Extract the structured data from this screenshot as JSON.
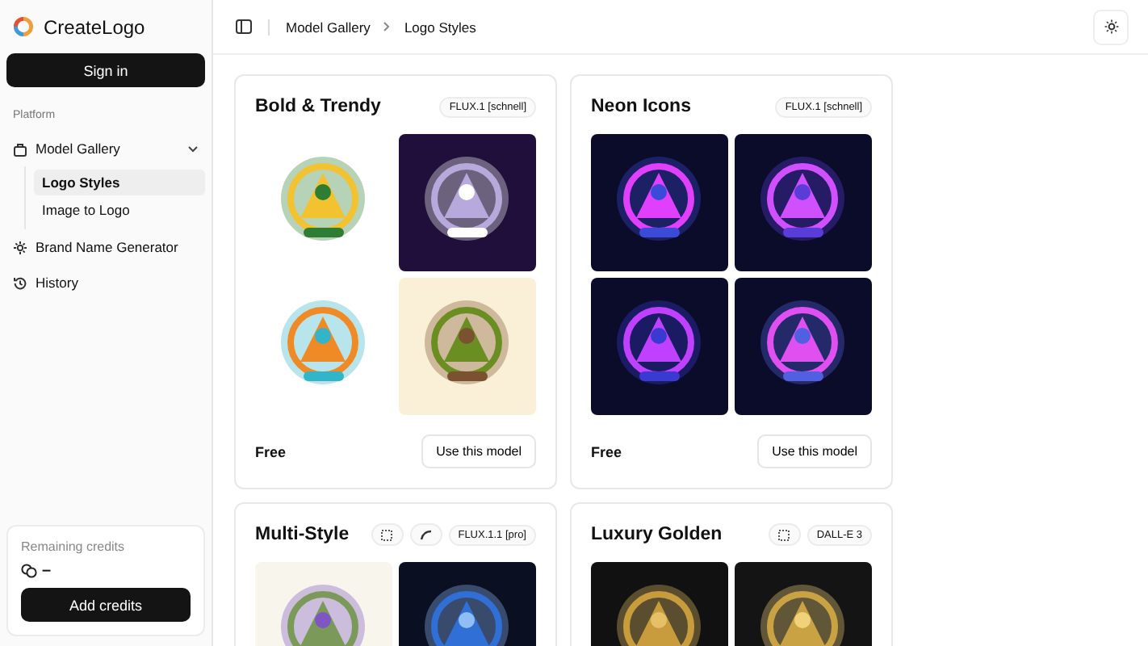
{
  "sidebar": {
    "brand": "CreateLogo",
    "sign_in": "Sign in",
    "section_label": "Platform",
    "items": [
      {
        "label": "Model Gallery",
        "kind": "group",
        "expanded": true,
        "children": [
          {
            "label": "Logo Styles",
            "selected": true
          },
          {
            "label": "Image to Logo",
            "selected": false
          }
        ]
      },
      {
        "label": "Brand Name Generator",
        "kind": "link"
      },
      {
        "label": "History",
        "kind": "link"
      }
    ],
    "credits": {
      "label": "Remaining credits",
      "value": "–",
      "button": "Add credits"
    }
  },
  "header": {
    "breadcrumb": [
      "Model Gallery",
      "Logo Styles"
    ]
  },
  "cards": [
    {
      "title": "Bold & Trendy",
      "badges": [
        {
          "kind": "text",
          "label": "FLUX.1 [schnell]"
        }
      ],
      "images": [
        {
          "kind": "picture"
        },
        {
          "kind": "picture"
        },
        {
          "kind": "picture"
        },
        {
          "kind": "picture"
        }
      ],
      "price": "Free",
      "button": "Use this model"
    },
    {
      "title": "Neon Icons",
      "badges": [
        {
          "kind": "text",
          "label": "FLUX.1 [schnell]"
        }
      ],
      "images": [
        {
          "kind": "picture"
        },
        {
          "kind": "picture"
        },
        {
          "kind": "picture"
        },
        {
          "kind": "picture"
        }
      ],
      "price": "Free",
      "button": "Use this model"
    },
    {
      "title": "Multi-Style",
      "badges": [
        {
          "kind": "icon"
        },
        {
          "kind": "icon"
        },
        {
          "kind": "text",
          "label": "FLUX.1.1 [pro]"
        }
      ],
      "images": [
        {
          "kind": "picture"
        },
        {
          "kind": "picture"
        }
      ]
    },
    {
      "title": "Luxury Golden",
      "badges": [
        {
          "kind": "icon"
        },
        {
          "kind": "text",
          "label": "DALL-E 3"
        }
      ],
      "images": [
        {
          "kind": "picture"
        },
        {
          "kind": "picture"
        }
      ]
    }
  ]
}
